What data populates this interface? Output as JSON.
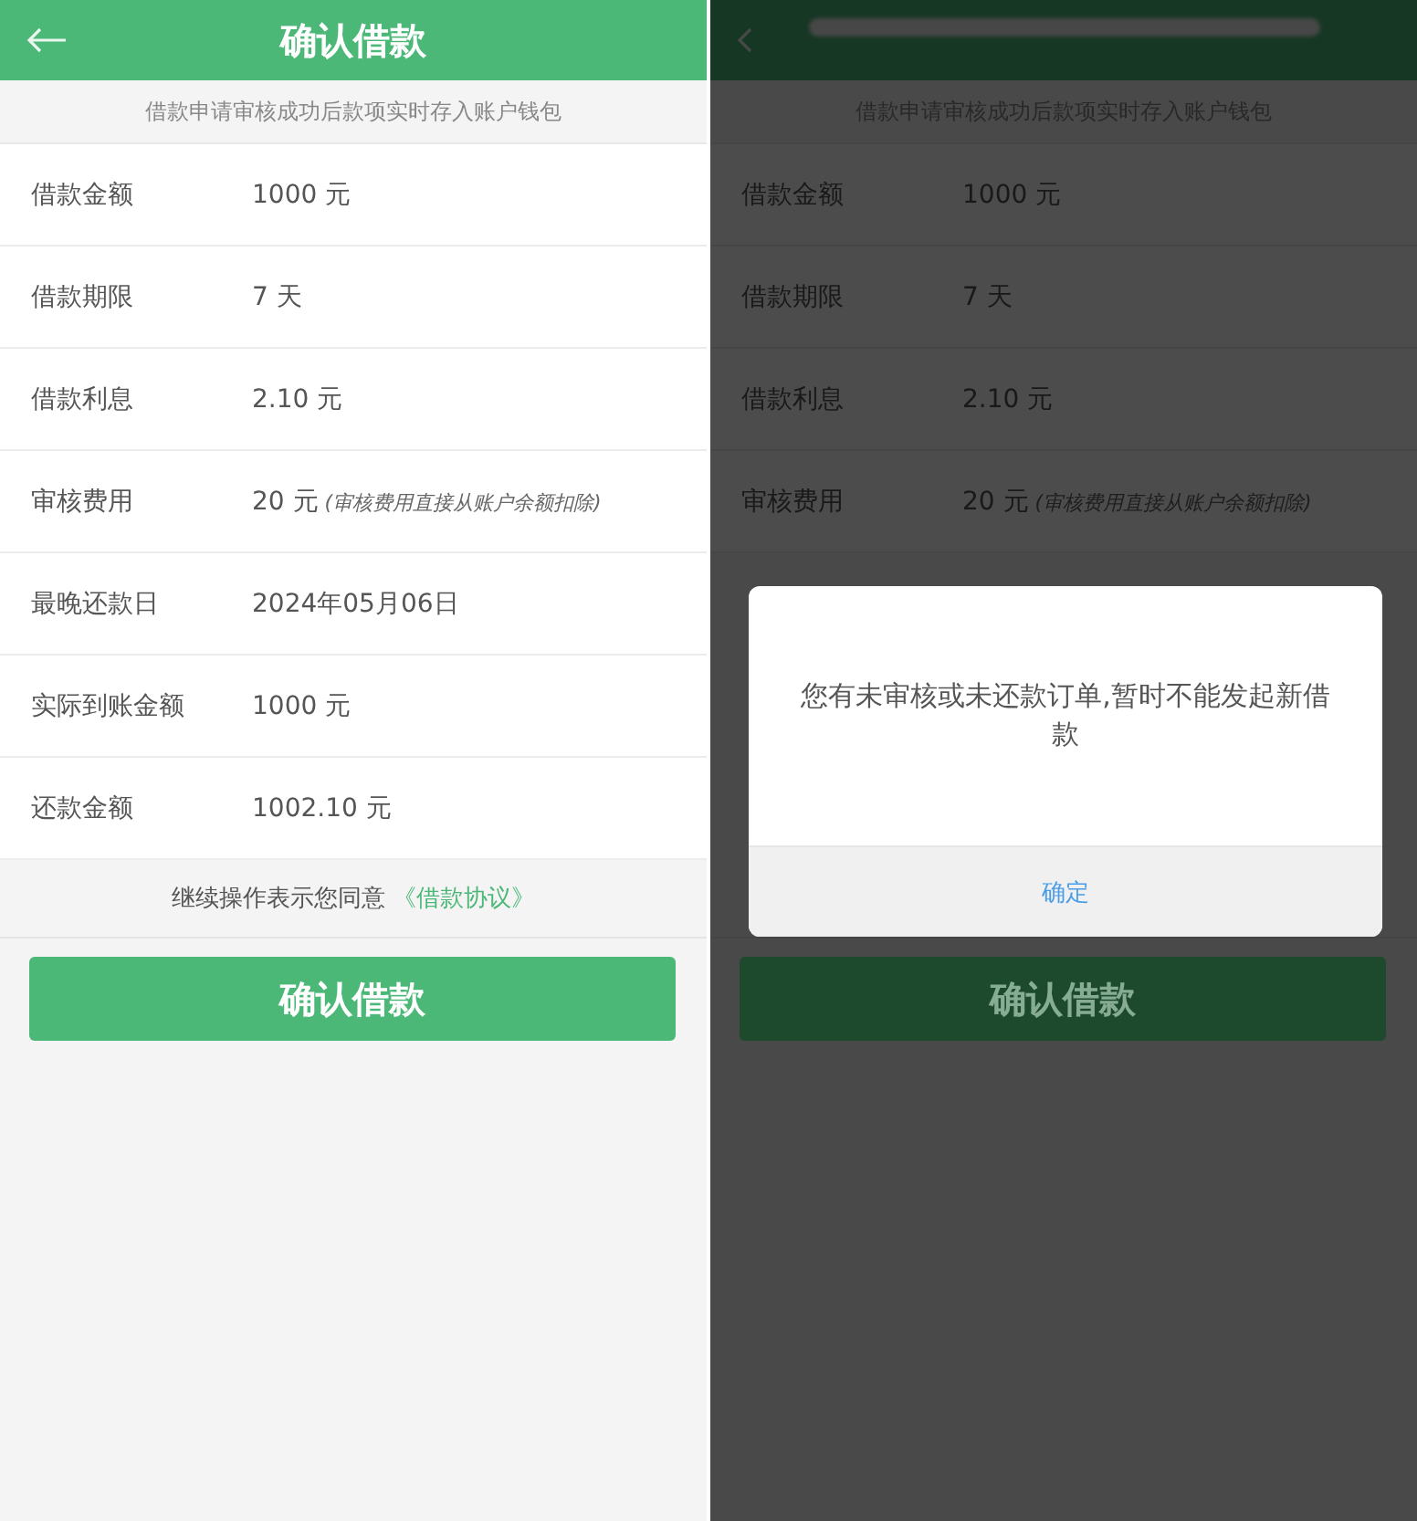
{
  "screens": [
    {
      "header": {
        "title": "确认借款",
        "kind": "arrow"
      },
      "notice": "借款申请审核成功后款项实时存入账户钱包",
      "rows": [
        {
          "label": "借款金额",
          "value": "1000 元"
        },
        {
          "label": "借款期限",
          "value": "7 天"
        },
        {
          "label": "借款利息",
          "value": "2.10 元"
        },
        {
          "label": "审核费用",
          "value": "20 元",
          "note": "(审核费用直接从账户余额扣除)"
        },
        {
          "label": "最晚还款日",
          "value": "2024年05月06日"
        },
        {
          "label": "实际到账金额",
          "value": "1000 元"
        },
        {
          "label": "还款金额",
          "value": "1002.10 元"
        }
      ],
      "agreement": {
        "text": "继续操作表示您同意",
        "link": "《借款协议》"
      },
      "confirm_button": "确认借款"
    },
    {
      "header": {
        "title_redacted": true,
        "kind": "chevron"
      },
      "notice": "借款申请审核成功后款项实时存入账户钱包",
      "rows": [
        {
          "label": "借款金额",
          "value": "1000 元"
        },
        {
          "label": "借款期限",
          "value": "7 天"
        },
        {
          "label": "借款利息",
          "value": "2.10 元"
        },
        {
          "label": "审核费用",
          "value": "20 元",
          "note": "(审核费用直接从账户余额扣除)"
        }
      ],
      "confirm_button": "确认借款",
      "dialog": {
        "message": "您有未审核或未还款订单,暂时不能发起新借款",
        "button": "确定"
      }
    }
  ]
}
